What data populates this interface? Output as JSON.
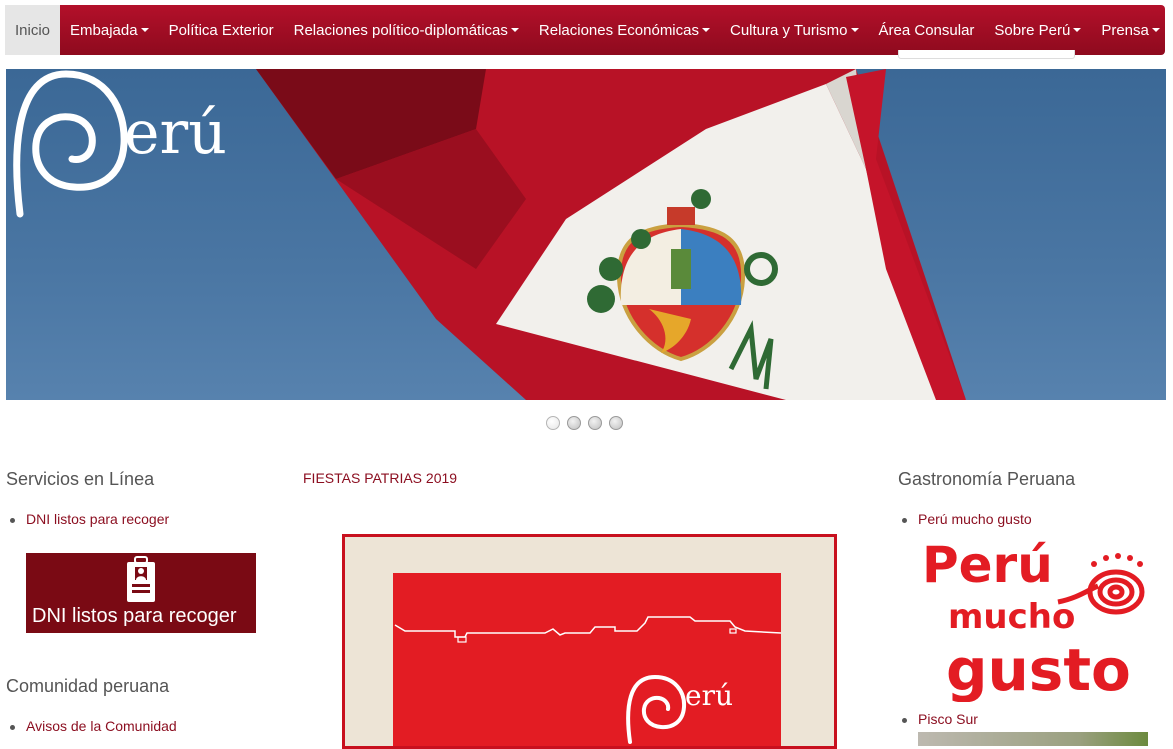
{
  "nav": {
    "items": [
      {
        "label": "Inicio",
        "dropdown": false,
        "active": true
      },
      {
        "label": "Embajada",
        "dropdown": true
      },
      {
        "label": "Política Exterior",
        "dropdown": false
      },
      {
        "label": "Relaciones político-diplomáticas",
        "dropdown": true
      },
      {
        "label": "Relaciones Económicas",
        "dropdown": true
      },
      {
        "label": "Cultura y Turismo",
        "dropdown": true
      },
      {
        "label": "Área Consular",
        "dropdown": false
      },
      {
        "label": "Sobre Perú",
        "dropdown": true
      },
      {
        "label": "Prensa",
        "dropdown": true
      }
    ]
  },
  "hero": {
    "logo_text": "erú",
    "slides": [
      {
        "active": true
      },
      {
        "active": false
      },
      {
        "active": false
      },
      {
        "active": false
      }
    ]
  },
  "left": {
    "services_title": "Servicios en Línea",
    "services_link": "DNI listos para recoger",
    "dni_banner_label": "DNI listos para recoger",
    "community_title": "Comunidad peruana",
    "community_link": "Avisos de la Comunidad"
  },
  "center": {
    "title": "FIESTAS PATRIAS 2019",
    "poster_logo": "erú"
  },
  "right": {
    "title": "Gastronomía Peruana",
    "link1": "Perú mucho gusto",
    "logo_line1": "Perú",
    "logo_line2": "mucho",
    "logo_line3": "gusto",
    "link2": "Pisco Sur"
  },
  "colors": {
    "nav_red": "#a30d24",
    "link_red": "#8b0d1f",
    "banner_red": "#7a0a14",
    "brand_red": "#e31c23",
    "sky": "#4a76a3"
  }
}
